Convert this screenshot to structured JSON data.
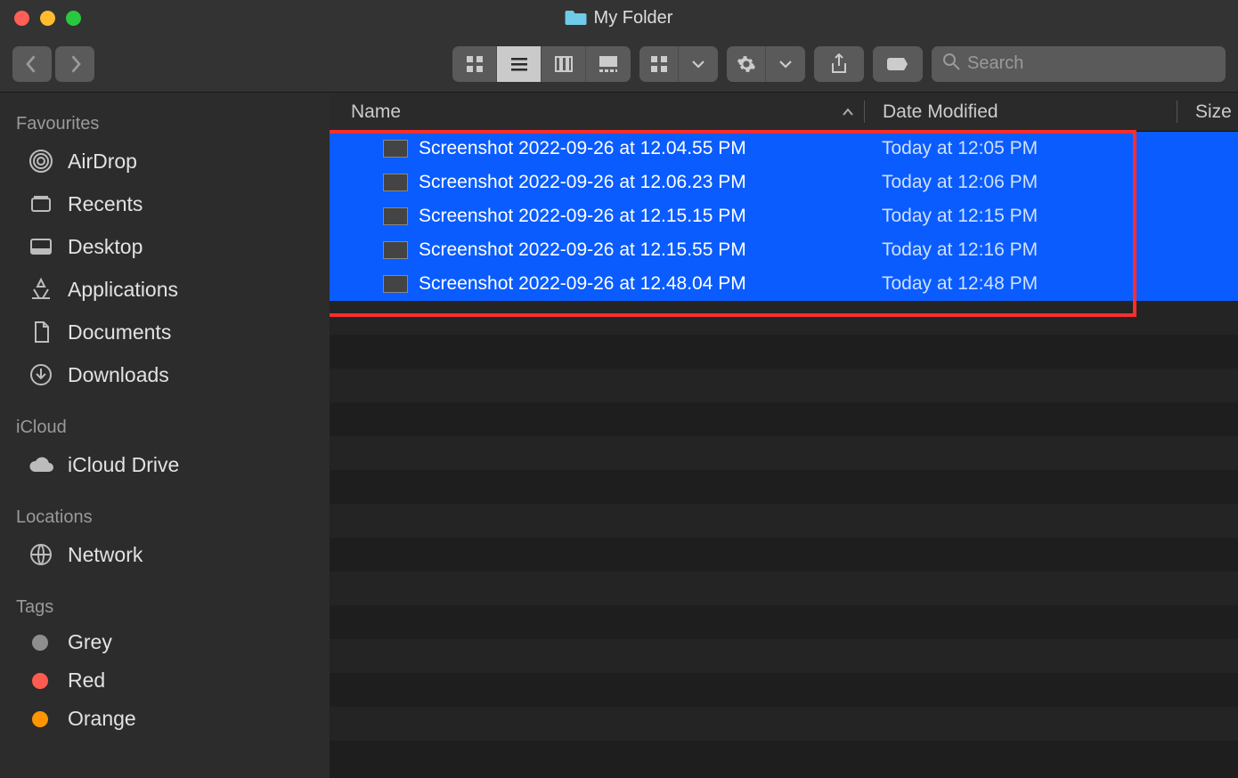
{
  "window": {
    "title": "My Folder"
  },
  "search": {
    "placeholder": "Search"
  },
  "columns": {
    "name": "Name",
    "date": "Date Modified",
    "size": "Size"
  },
  "sidebar": {
    "favourites_label": "Favourites",
    "icloud_label": "iCloud",
    "locations_label": "Locations",
    "tags_label": "Tags",
    "favourites": [
      {
        "label": "AirDrop"
      },
      {
        "label": "Recents"
      },
      {
        "label": "Desktop"
      },
      {
        "label": "Applications"
      },
      {
        "label": "Documents"
      },
      {
        "label": "Downloads"
      }
    ],
    "icloud": [
      {
        "label": "iCloud Drive"
      }
    ],
    "locations": [
      {
        "label": "Network"
      }
    ],
    "tags": [
      {
        "label": "Grey"
      },
      {
        "label": "Red"
      },
      {
        "label": "Orange"
      }
    ]
  },
  "files": [
    {
      "name": "Screenshot 2022-09-26 at 12.04.55 PM",
      "modified": "Today at 12:05 PM"
    },
    {
      "name": "Screenshot 2022-09-26 at 12.06.23 PM",
      "modified": "Today at 12:06 PM"
    },
    {
      "name": "Screenshot 2022-09-26 at 12.15.15 PM",
      "modified": "Today at 12:15 PM"
    },
    {
      "name": "Screenshot 2022-09-26 at 12.15.55 PM",
      "modified": "Today at 12:16 PM"
    },
    {
      "name": "Screenshot 2022-09-26 at 12.48.04 PM",
      "modified": "Today at 12:48 PM"
    }
  ]
}
